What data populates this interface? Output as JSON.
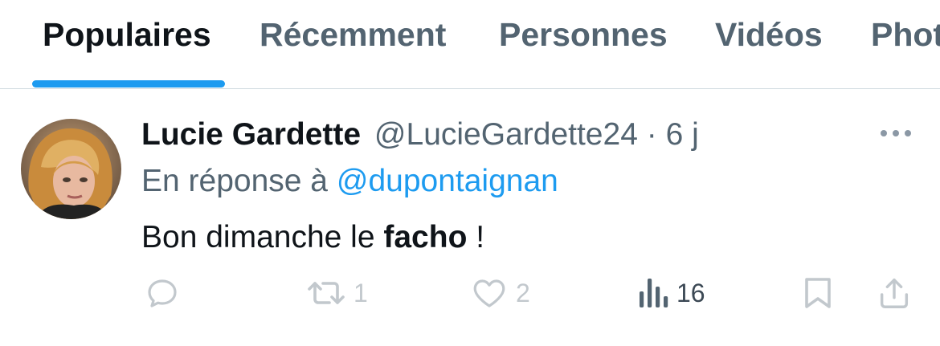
{
  "tabs": [
    {
      "label": "Populaires",
      "active": true
    },
    {
      "label": "Récemment"
    },
    {
      "label": "Personnes"
    },
    {
      "label": "Vidéos"
    },
    {
      "label": "Phot"
    }
  ],
  "tweet": {
    "author_name": "Lucie Gardette",
    "handle": "@LucieGardette24",
    "separator": "·",
    "time": "6 j",
    "reply_prefix": "En réponse à",
    "reply_to": "@dupontaignan",
    "text_before": "Bon dimanche le",
    "text_bold": "facho",
    "text_after": "!",
    "actions": {
      "replies": "",
      "retweets": "1",
      "likes": "2",
      "views": "16"
    }
  },
  "colors": {
    "accent": "#1d9bf0",
    "muted": "#536471",
    "text": "#0f1419",
    "divider": "#cfd9de"
  },
  "icons": [
    "reply-icon",
    "retweet-icon",
    "like-icon",
    "views-icon",
    "bookmark-icon",
    "share-icon",
    "more-icon"
  ]
}
